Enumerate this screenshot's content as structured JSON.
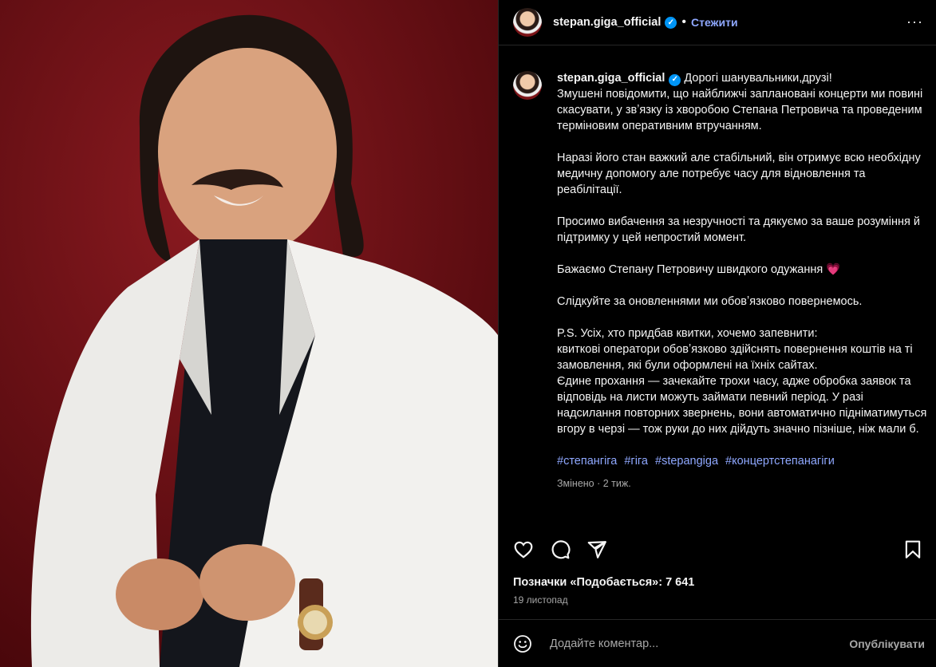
{
  "post": {
    "username": "stepan.giga_official",
    "follow_label": "Стежити",
    "dot": "•",
    "more": "···",
    "caption_paragraphs": [
      "Дорогі шанувальники,друзі!\nЗмушені повідомити, що найближчі заплановані концерти ми повині скасувати, у звʼязку із хворобою Степана Петровича та проведеним терміновим оперативним втручанням.",
      "Наразі його стан важкий але стабільний, він отримує всю необхідну медичну допомогу але потребує часу для відновлення та реабілітації.",
      "Просимо вибачення за незручності та дякуємо за ваше розуміння й підтримку у цей непростий момент.",
      "Бажаємо Степану Петровичу швидкого одужання",
      "Слідкуйте за оновленнями ми обовʼязково повернемось.",
      "P.S. Усіх, хто придбав квитки, хочемо запевнити:\nквиткові оператори обовʼязково здійснять повернення коштів на ті замовлення, які були оформлені на їхніх сайтах.\nЄдине прохання — зачекайте трохи часу, адже обробка заявок та відповідь на листи можуть займати певний період. У разі надсилання повторних звернень, вони автоматично підніматимуться вгору в черзі — тож руки до них дійдуть значно пізніше, ніж мали б."
    ],
    "heart_emoji": "💗",
    "hashtags": [
      "#степангіга",
      "#гіга",
      "#stepangiga",
      "#концертстепанагіги"
    ],
    "edited_label": "Змінено · 2 тиж.",
    "likes_text": "Позначки «Подобається»: 7 641",
    "date": "19 листопад",
    "comment_placeholder": "Додайте коментар...",
    "publish_label": "Опублікувати"
  },
  "colors": {
    "background": "#000000",
    "link": "#8fa8ff",
    "verified": "#0095f6",
    "photo_bg": "#6b0f14"
  },
  "icons": [
    "verified-icon",
    "like-icon",
    "comment-icon",
    "share-icon",
    "save-icon",
    "emoji-icon"
  ]
}
